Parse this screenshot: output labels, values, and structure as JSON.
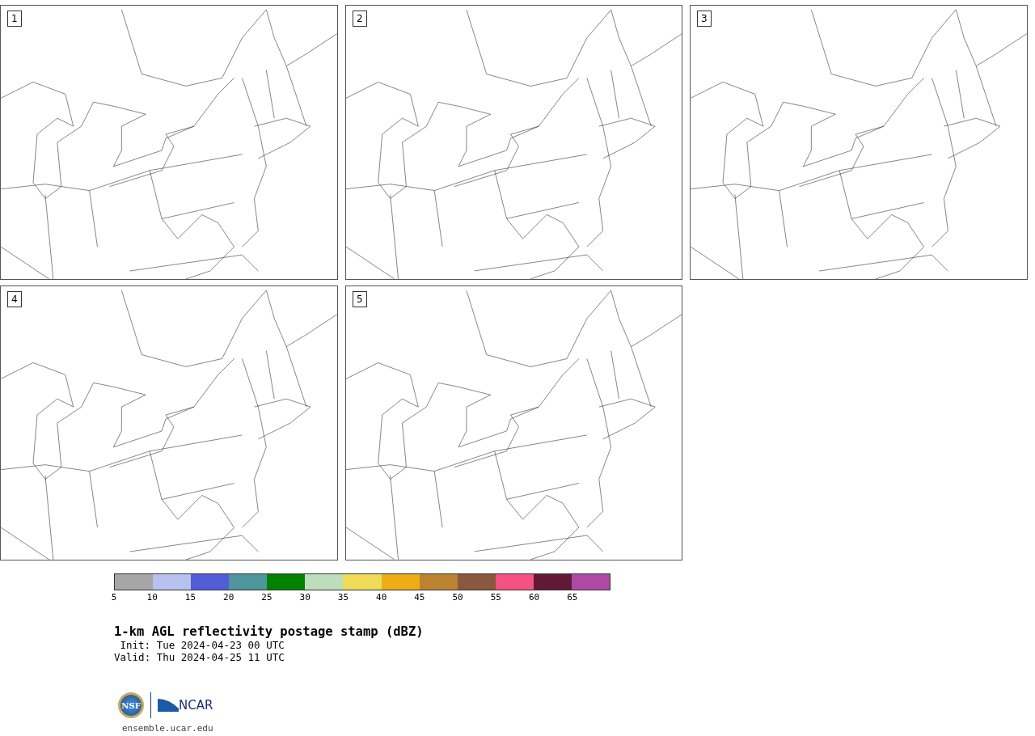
{
  "panels": [
    {
      "label": "1"
    },
    {
      "label": "2"
    },
    {
      "label": "3"
    },
    {
      "label": "4"
    },
    {
      "label": "5"
    }
  ],
  "colorbar": {
    "bins": [
      {
        "tick": "5",
        "color": "#a6a6a6"
      },
      {
        "tick": "10",
        "color": "#b8c2ee"
      },
      {
        "tick": "15",
        "color": "#535dd8"
      },
      {
        "tick": "20",
        "color": "#4f969c"
      },
      {
        "tick": "25",
        "color": "#008200"
      },
      {
        "tick": "30",
        "color": "#bedebb"
      },
      {
        "tick": "35",
        "color": "#eedb5a"
      },
      {
        "tick": "40",
        "color": "#eead17"
      },
      {
        "tick": "45",
        "color": "#bb8330"
      },
      {
        "tick": "50",
        "color": "#89583f"
      },
      {
        "tick": "55",
        "color": "#f45281"
      },
      {
        "tick": "60",
        "color": "#621837"
      },
      {
        "tick": "65",
        "color": "#ae4aa6"
      }
    ]
  },
  "title": "1-km AGL reflectivity postage stamp (dBZ)",
  "init": "Init: Tue 2024-04-23 00 UTC",
  "valid": "Valid: Thu 2024-04-25 11 UTC",
  "logo": {
    "seal": "NSF",
    "wordmark": "NCAR"
  },
  "url": "ensemble.ucar.edu"
}
